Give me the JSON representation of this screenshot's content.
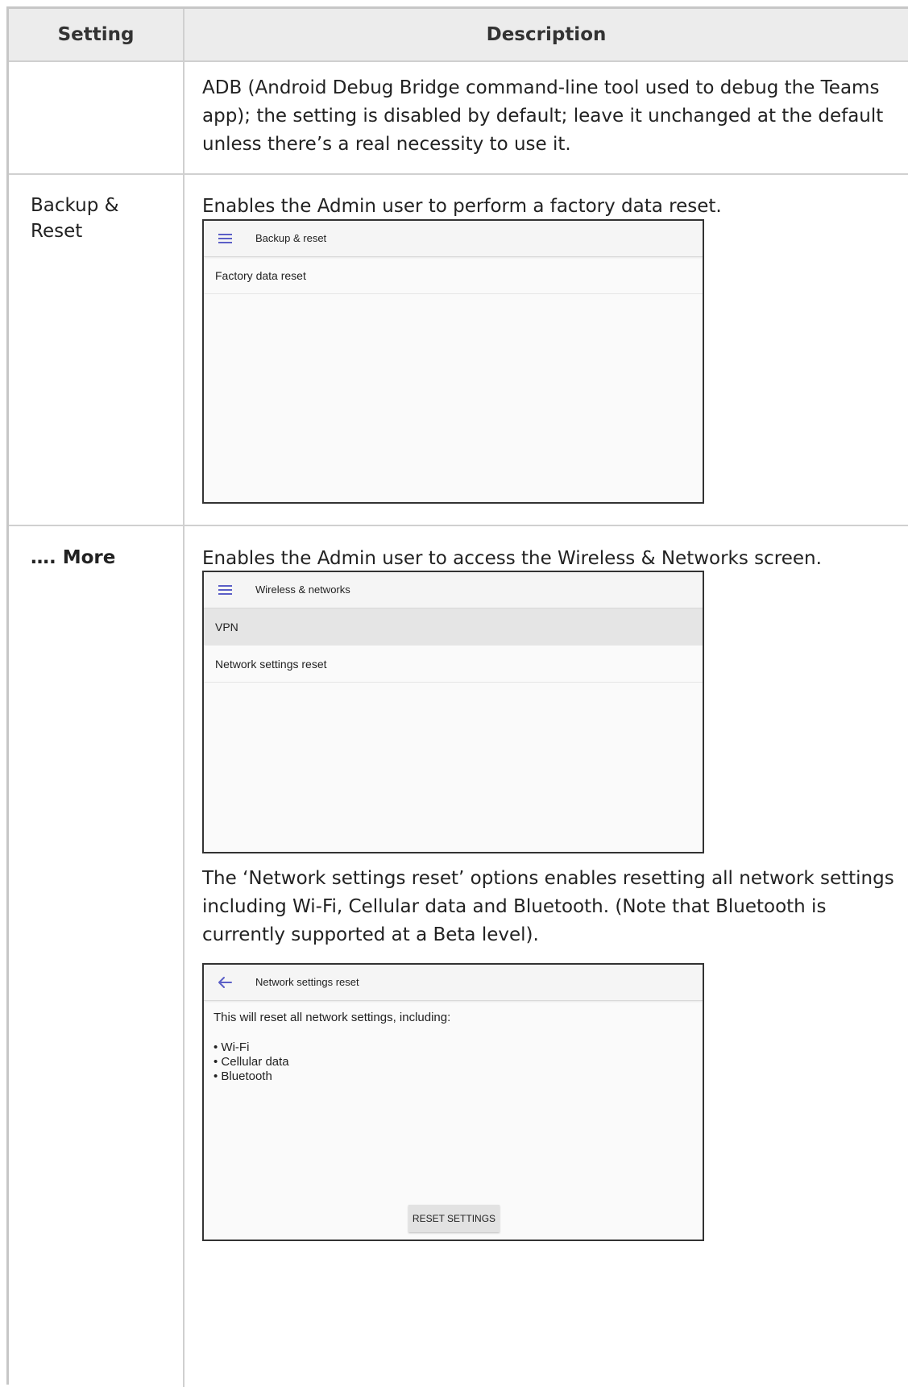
{
  "table": {
    "headers": {
      "setting": "Setting",
      "description": "Description"
    },
    "rows": [
      {
        "setting": "",
        "description": "ADB (Android Debug Bridge command-line tool used to debug the Teams app); the setting is disabled by default; leave it unchanged at the default unless there’s a real necessity to use it."
      },
      {
        "setting_line1": "Backup &",
        "setting_line2": "Reset",
        "description": "Enables the Admin user to perform a factory data reset.",
        "screen": {
          "icon": "menu-icon",
          "title": "Backup & reset",
          "items": [
            "Factory data reset"
          ]
        }
      },
      {
        "setting": "…. More",
        "description": "Enables the Admin user to access the Wireless & Networks screen.",
        "screen": {
          "icon": "menu-icon",
          "title": "Wireless & networks",
          "items": [
            "VPN",
            "Network settings reset"
          ],
          "selected_item": "VPN"
        },
        "note": "The ‘Network settings reset’ options enables resetting all network settings including Wi-Fi, Cellular data and Bluetooth. (Note that Bluetooth is currently supported at a Beta level).",
        "screen2": {
          "icon": "back-arrow-icon",
          "title": "Network settings reset",
          "message": "This will reset all network settings, including:",
          "bullets": [
            "• Wi-Fi",
            "• Cellular data",
            "• Bluetooth"
          ],
          "button": "RESET SETTINGS"
        }
      }
    ]
  },
  "colors": {
    "accent": "#5b5fc7",
    "border": "#c7c7c7",
    "header_bg": "#ececec"
  }
}
